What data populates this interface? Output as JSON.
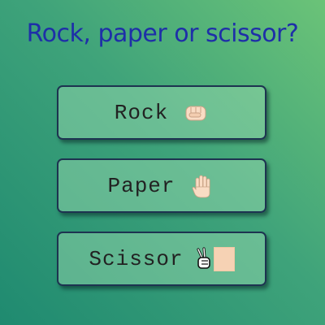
{
  "title": "Rock, paper or scissor?",
  "buttons": [
    {
      "label": "Rock",
      "icon": "fist-icon"
    },
    {
      "label": "Paper",
      "icon": "raised-hand-icon"
    },
    {
      "label": "Scissor",
      "icon": "victory-hand-icon"
    }
  ],
  "colors": {
    "title": "#1e2fa8",
    "border": "#1d3350",
    "skin": "#f6d2b4",
    "gradient_top_right": "#6bc378",
    "gradient_bottom_left": "#1f8a70"
  }
}
